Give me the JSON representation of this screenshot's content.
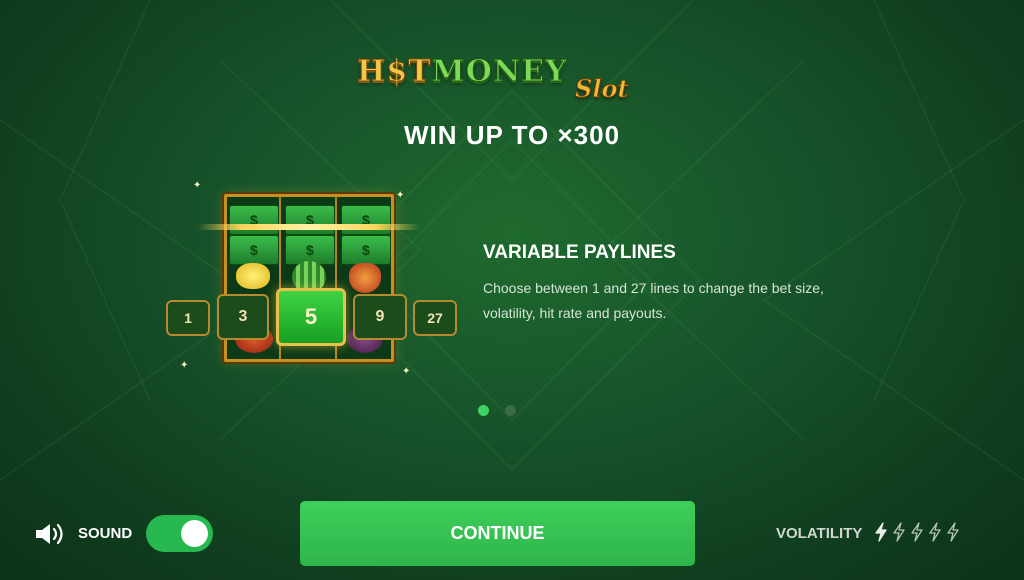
{
  "logo": {
    "word1": "H$T",
    "word2": "MONEY",
    "sub": "Slot"
  },
  "headline": "WIN UP TO ×300",
  "slot": {
    "line_options": [
      "1",
      "3",
      "5",
      "9",
      "27"
    ],
    "selected_line": "5"
  },
  "feature": {
    "title": "VARIABLE PAYLINES",
    "description": "Choose between 1 and 27 lines to change the bet size, volatility, hit rate and payouts."
  },
  "pagination": {
    "current": 1,
    "total": 2
  },
  "sound": {
    "label": "SOUND",
    "enabled": true
  },
  "continue_label": "CONTINUE",
  "volatility": {
    "label": "VOLATILITY",
    "level": 1,
    "max": 5
  },
  "colors": {
    "accent_green": "#3fcf5b",
    "gold": "#c8901f",
    "background": "#17532a"
  },
  "icons": [
    "speaker-icon",
    "lightning-bolt-icon"
  ]
}
